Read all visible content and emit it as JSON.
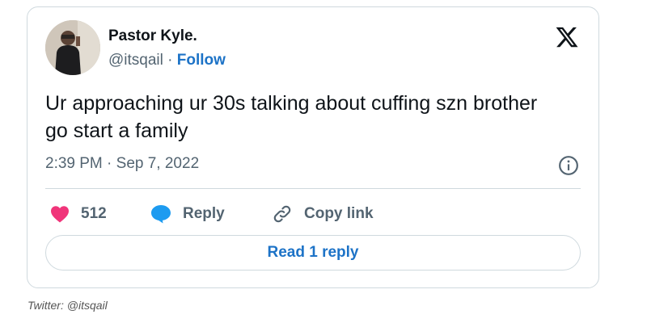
{
  "tweet": {
    "author_name": "Pastor Kyle.",
    "handle": "@itsqail",
    "separator": " · ",
    "follow_label": "Follow",
    "text": "Ur approaching ur 30s talking about cuffing szn brother go start a family",
    "time": "2:39 PM",
    "date_separator": " · ",
    "date": "Sep 7, 2022",
    "likes": "512",
    "reply_label": "Reply",
    "copy_link_label": "Copy link",
    "read_replies_label": "Read 1 reply"
  },
  "caption": "Twitter: @itsqail",
  "icons": {
    "brand": "x-logo-icon",
    "info": "info-icon",
    "like": "heart-icon",
    "reply": "speech-bubble-icon",
    "copy": "link-icon"
  },
  "colors": {
    "link": "#1d73c7",
    "heart": "#f0357a",
    "reply_bubble": "#1d9bf0",
    "text": "#0f1419",
    "muted": "#536471"
  }
}
